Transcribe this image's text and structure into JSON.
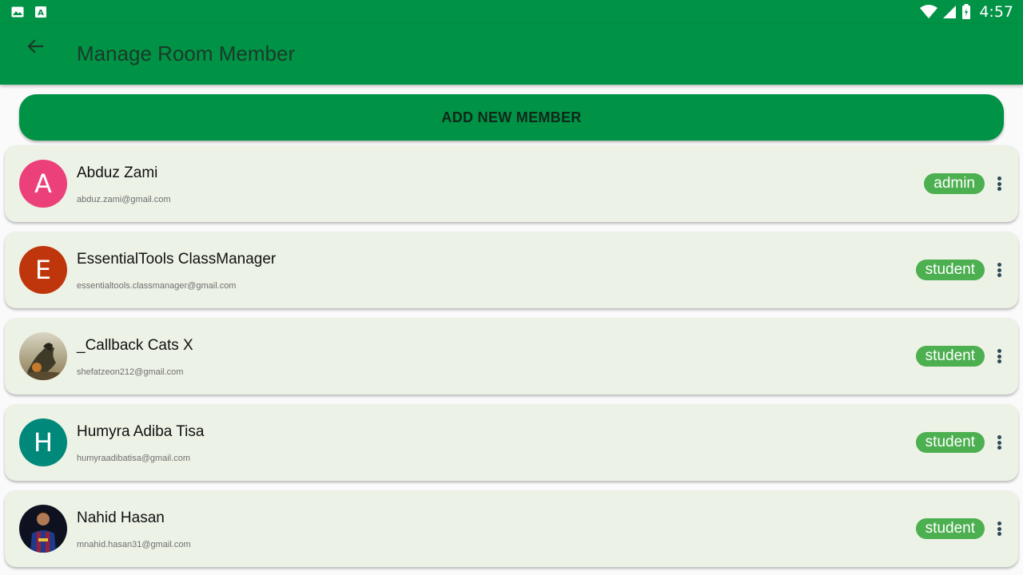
{
  "status_bar": {
    "time": "4:57",
    "left_icons": [
      "image-icon",
      "app-a-icon"
    ],
    "right_icons": [
      "wifi-icon",
      "signal-icon",
      "battery-icon"
    ]
  },
  "app_bar": {
    "title": "Manage Room Member",
    "back_icon": "arrow-left-icon"
  },
  "add_button": {
    "label": "ADD NEW MEMBER"
  },
  "members": [
    {
      "name": "Abduz Zami",
      "email": "abduz.zami@gmail.com",
      "role": "admin",
      "avatar_letter": "A",
      "avatar_color": "#ec407a",
      "avatar_type": "letter"
    },
    {
      "name": "EssentialTools ClassManager",
      "email": "essentialtools.classmanager@gmail.com",
      "role": "student",
      "avatar_letter": "E",
      "avatar_color": "#bf360c",
      "avatar_type": "letter"
    },
    {
      "name": "_Callback Cats X",
      "email": "shefatzeon212@gmail.com",
      "role": "student",
      "avatar_letter": "",
      "avatar_color": "#8a7f5a",
      "avatar_type": "photo"
    },
    {
      "name": "Humyra Adiba Tisa",
      "email": "humyraadibatisa@gmail.com",
      "role": "student",
      "avatar_letter": "H",
      "avatar_color": "#00897b",
      "avatar_type": "letter"
    },
    {
      "name": "Nahid Hasan",
      "email": "mnahid.hasan31@gmail.com",
      "role": "student",
      "avatar_letter": "",
      "avatar_color": "#1a2a5a",
      "avatar_type": "photo"
    }
  ],
  "colors": {
    "primary": "#009245",
    "card_bg": "#edf2e6",
    "badge": "#4caf50"
  }
}
